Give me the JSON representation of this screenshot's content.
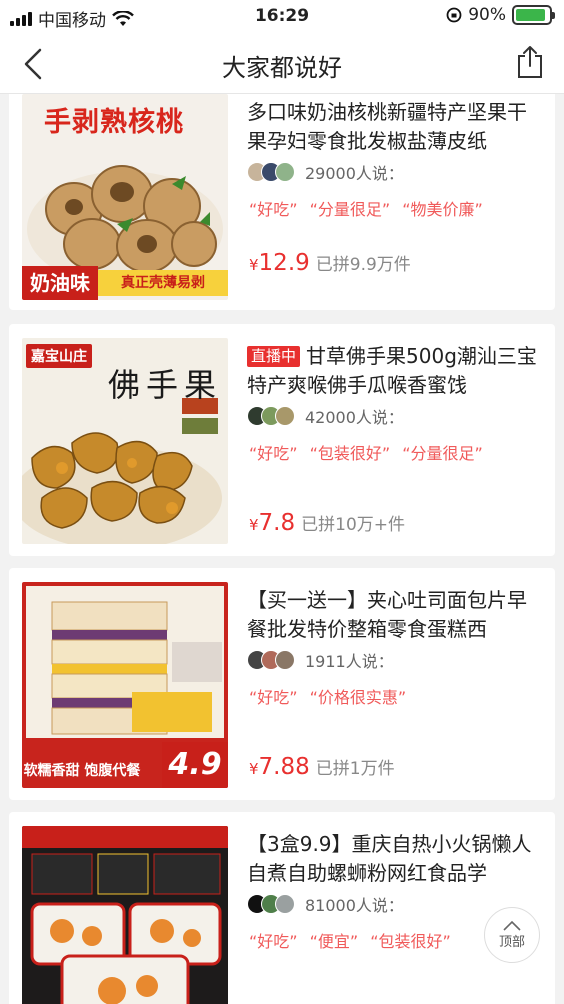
{
  "status": {
    "carrier": "中国移动",
    "time": "16:29",
    "battery": "90%"
  },
  "nav": {
    "title": "大家都说好"
  },
  "products": [
    {
      "tag": "",
      "title": "多口味奶油核桃新疆特产坚果干果孕妇零食批发椒盐薄皮纸",
      "people_count": "29000人说：",
      "quotes": [
        "“好吃”",
        "“分量很足”",
        "“物美价廉”"
      ],
      "price_symbol": "¥",
      "price": "12.9",
      "sold": "已拼9.9万件",
      "image_text": {
        "headline": "手剥熟核桃",
        "badge": "奶油味",
        "sub": "真正壳薄易剥"
      }
    },
    {
      "tag": "直播中",
      "title": "甘草佛手果500g潮汕三宝特产爽喉佛手瓜喉香蜜饯",
      "people_count": "42000人说：",
      "quotes": [
        "“好吃”",
        "“包装很好”",
        "“分量很足”"
      ],
      "price_symbol": "¥",
      "price": "7.8",
      "sold": "已拼10万+件",
      "image_text": {
        "brand": "嘉宝山庄",
        "headline": "佛手果"
      }
    },
    {
      "tag": "",
      "title": "【买一送一】夹心吐司面包片早餐批发特价整箱零食蛋糕西",
      "people_count": "1911人说：",
      "quotes": [
        "“好吃”",
        "“价格很实惠”"
      ],
      "price_symbol": "¥",
      "price": "7.88",
      "sold": "已拼1万件",
      "image_text": {
        "sub": "软糯香甜 饱腹代餐",
        "price": "4.9"
      }
    },
    {
      "tag": "",
      "title": "【3盒9.9】重庆自热小火锅懒人自煮自助螺蛳粉网红食品学",
      "people_count": "81000人说：",
      "quotes": [
        "“好吃”",
        "“便宜”",
        "“包装很好”"
      ],
      "price_symbol": "",
      "price": "",
      "sold": "",
      "image_text": {}
    }
  ],
  "top_button": {
    "label": "顶部"
  },
  "colors": {
    "accent": "#e8302f",
    "quote": "#f05a5a"
  }
}
